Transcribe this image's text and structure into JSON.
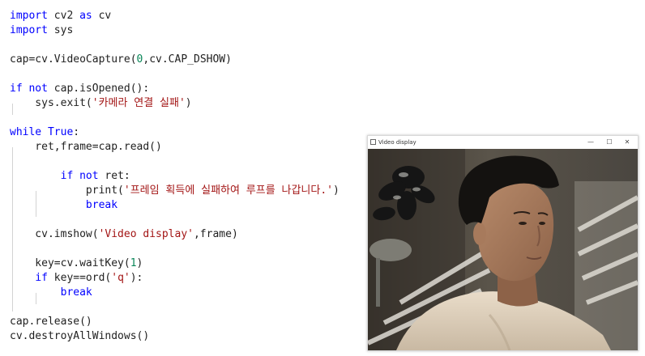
{
  "code": {
    "l1": {
      "a": "import",
      "b": " cv2 ",
      "c": "as",
      "d": " cv"
    },
    "l2": {
      "a": "import",
      "b": " sys"
    },
    "l4": {
      "a": "cap=cv.VideoCapture(",
      "b": "0",
      "c": ",cv.CAP_DSHOW)"
    },
    "l6": {
      "a": "if",
      "b": " ",
      "c": "not",
      "d": " cap.isOpened():"
    },
    "l7": {
      "a": "    sys.exit(",
      "b": "'카메라 연결 실패'",
      "c": ")"
    },
    "l9": {
      "a": "while",
      "b": " ",
      "c": "True",
      "d": ":"
    },
    "l10": {
      "a": "    ret,frame=cap.read()"
    },
    "l12": {
      "a": "        ",
      "b": "if",
      "c": " ",
      "d": "not",
      "e": " ret:"
    },
    "l13": {
      "a": "            print(",
      "b": "'프레임 획득에 실패하여 루프를 나갑니다.'",
      "c": ")"
    },
    "l14": {
      "a": "            ",
      "b": "break"
    },
    "l16": {
      "a": "    cv.imshow(",
      "b": "'Video display'",
      "c": ",frame)"
    },
    "l18": {
      "a": "    key=cv.waitKey(",
      "b": "1",
      "c": ")"
    },
    "l19": {
      "a": "    ",
      "b": "if",
      "c": " key==ord(",
      "d": "'q'",
      "e": "):"
    },
    "l20": {
      "a": "        ",
      "b": "break"
    },
    "l22": {
      "a": "cap.release()"
    },
    "l23": {
      "a": "cv.destroyAllWindows()"
    }
  },
  "window": {
    "title": "Video display",
    "minimize_glyph": "—",
    "maximize_glyph": "☐",
    "close_glyph": "✕"
  },
  "colors": {
    "keyword": "#0000ff",
    "string": "#a31515",
    "number": "#098658",
    "text": "#1f1f1f"
  }
}
